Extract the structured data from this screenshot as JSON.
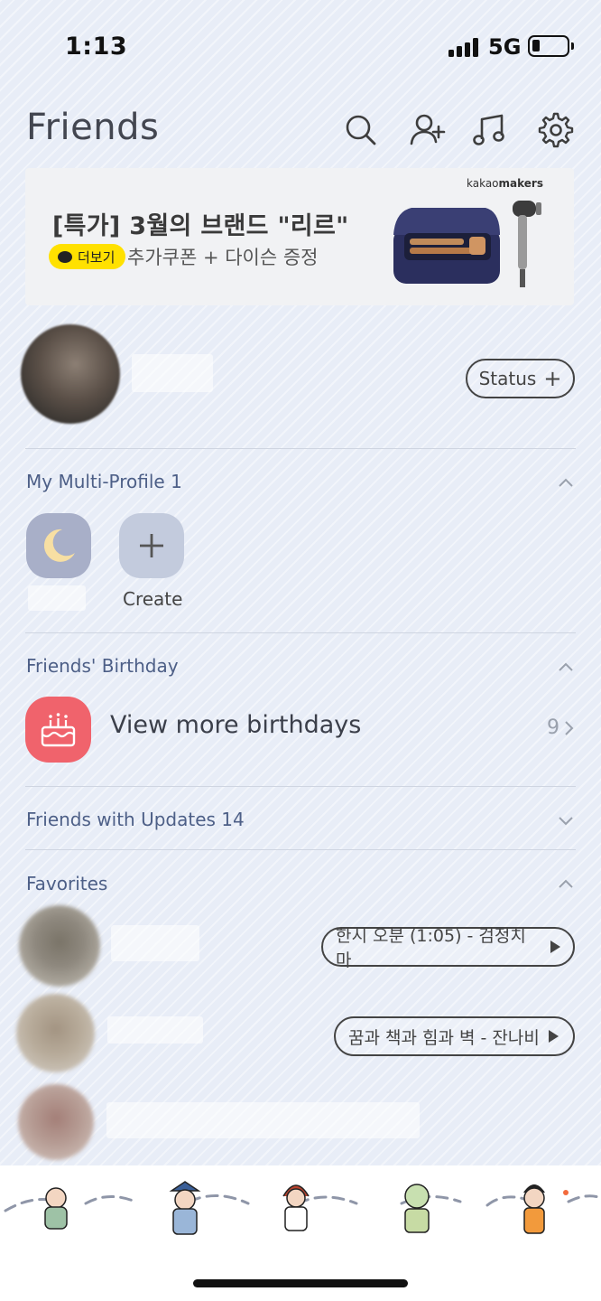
{
  "status_bar": {
    "time": "1:13",
    "network": "5G"
  },
  "header": {
    "title": "Friends"
  },
  "ad": {
    "brand_prefix": "kakao",
    "brand_suffix": "makers",
    "headline": "[특가] 3월의 브랜드 \"리르\"",
    "more_label": "더보기",
    "subtext": "추가쿠폰 + 다이슨 증정"
  },
  "my_profile": {
    "status_label": "Status"
  },
  "multi_profile": {
    "title": "My Multi-Profile 1",
    "create_label": "Create"
  },
  "birthday": {
    "title": "Friends' Birthday",
    "label": "View more birthdays",
    "count": "9"
  },
  "updates": {
    "title": "Friends with Updates 14"
  },
  "favorites": {
    "title": "Favorites",
    "items": [
      {
        "song": "한시 오분 (1:05) - 검정치마"
      },
      {
        "song": "꿈과 책과 힘과 벽 - 잔나비"
      },
      {
        "song": ""
      }
    ]
  },
  "colors": {
    "background": "#e8edf7",
    "section_title": "#4d5f87",
    "birthday_icon": "#f0636c",
    "kakao_yellow": "#ffe100"
  },
  "icons": [
    "search-icon",
    "add-friend-icon",
    "music-icon",
    "settings-icon",
    "moon-icon",
    "plus-icon",
    "cake-icon",
    "chevron-up-icon",
    "chevron-down-icon",
    "play-icon"
  ]
}
